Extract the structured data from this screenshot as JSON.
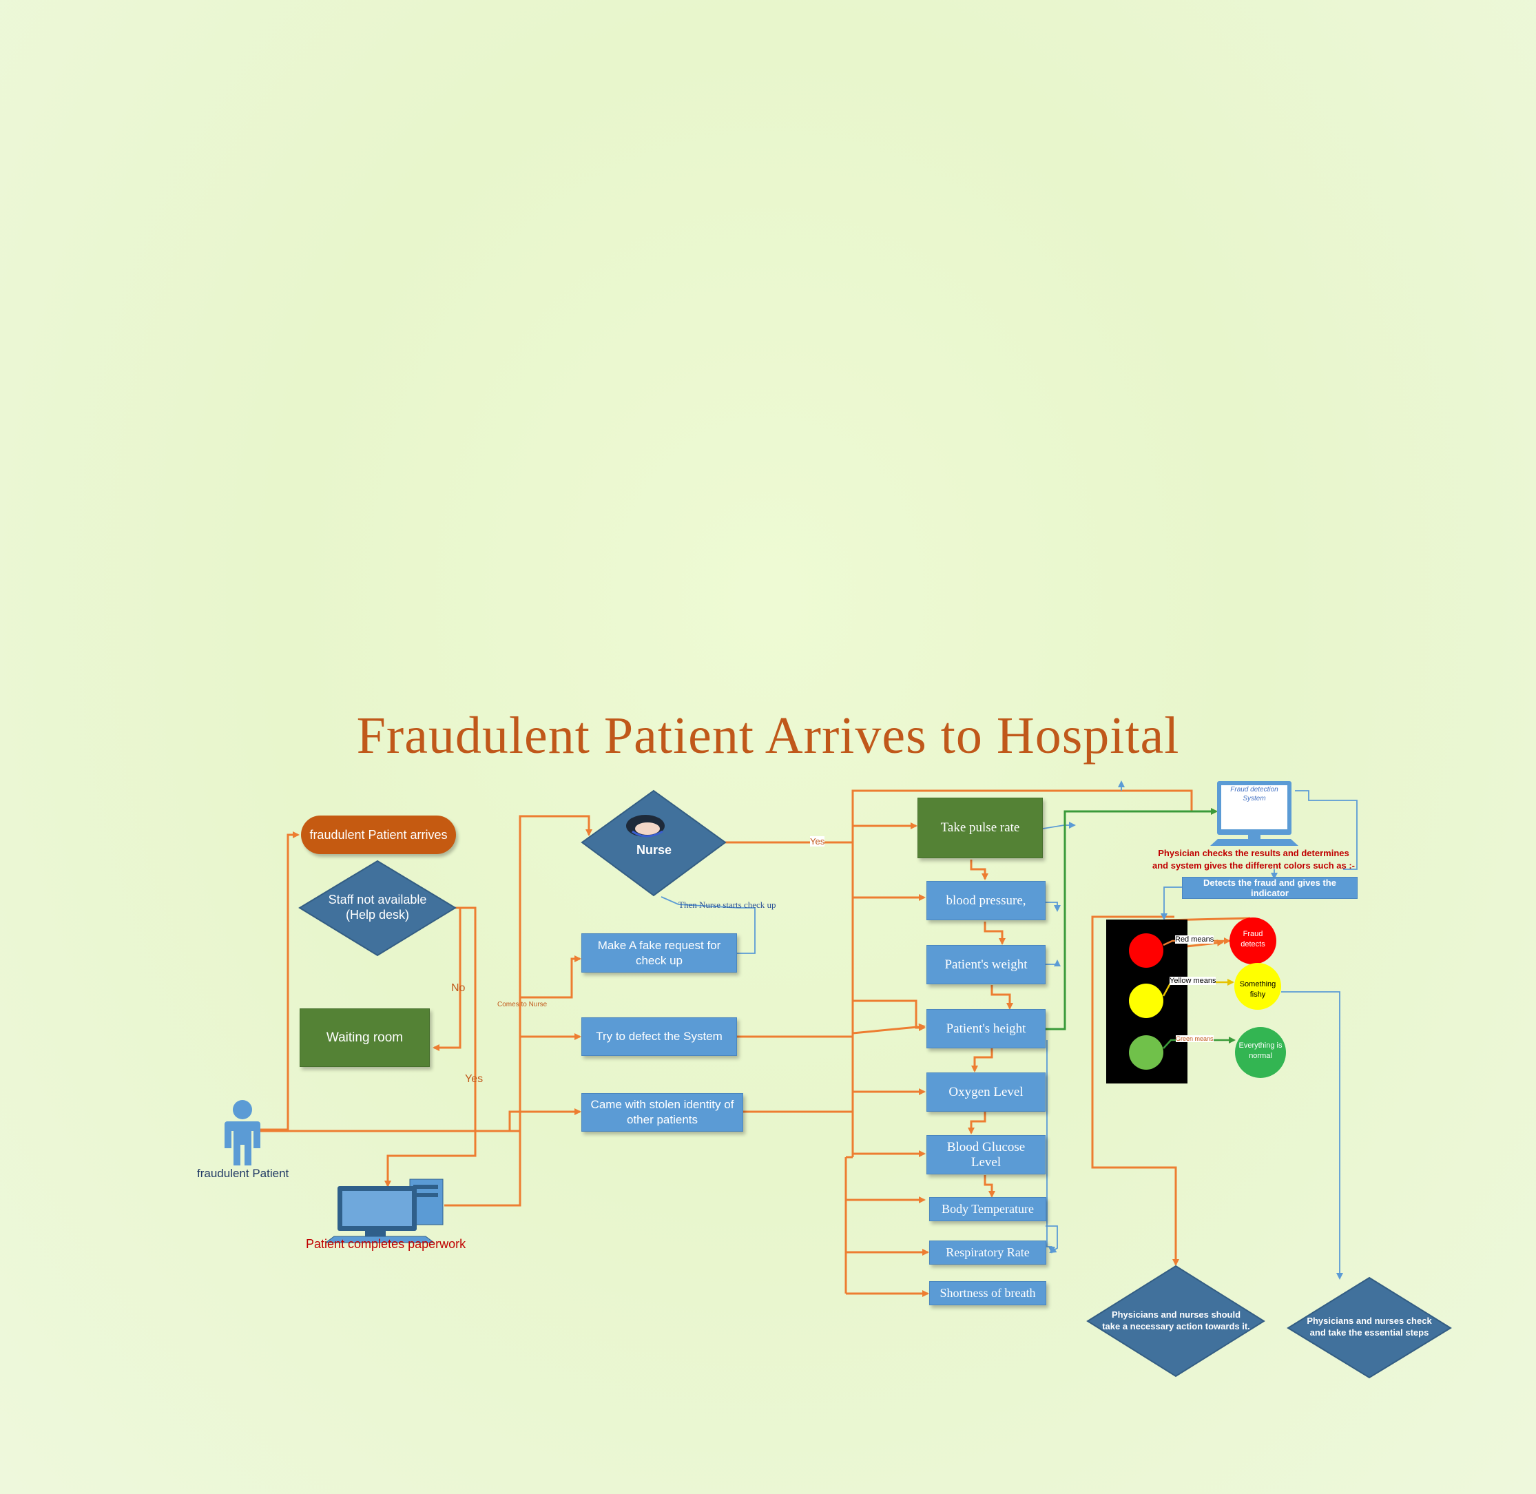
{
  "title": "Fraudulent Patient Arrives to Hospital",
  "colors": {
    "orange": "#ed7d31",
    "blue_box": "#5b9bd5",
    "green_box": "#548235",
    "diamond": "#41719c",
    "title": "#c0581a",
    "red": "#ff0000",
    "yellow": "#ffff00",
    "light_green": "#70c14a"
  },
  "icons": {
    "patient": "person-icon",
    "computer": "computer-icon",
    "nurse": "nurse-avatar-icon",
    "fds": "monitor-icon"
  },
  "left": {
    "arrives": "fraudulent Patient arrives",
    "staff_line1": "Staff not available",
    "staff_line2": "(Help desk)",
    "waiting": "Waiting room",
    "patient_label": "fraudulent Patient",
    "paperwork": "Patient completes paperwork",
    "no": "No",
    "yes": "Yes"
  },
  "middle": {
    "nurse": "Nurse",
    "then_nurse": "Then Nurse starts check up",
    "fake_request": "Make A fake request for check up",
    "defect": "Try to defect the System",
    "stolen": "Came with stolen identity of other patients",
    "comes_to_nurse": "Comes to Nurse",
    "yes": "Yes"
  },
  "checks": [
    "Take pulse rate",
    "blood pressure,",
    "Patient's  weight",
    "Patient's height",
    "Oxygen Level",
    "Blood Glucose Level",
    "Body Temperature",
    "Respiratory Rate",
    "Shortness of breath"
  ],
  "system": {
    "fds_label": "Fraud detection System",
    "physician_note": "Physician checks the results and determines and system gives the different colors such as :-",
    "detects": "Detects the fraud and gives the indicator",
    "red_means": "Red means",
    "yellow_means": "Yellow means",
    "green_means": "Green means",
    "fraud": "Fraud detects",
    "fishy": "Something fishy",
    "normal": "Everything is normal",
    "action1": "Physicians and nurses should take a necessary  action towards it.",
    "action2": "Physicians and nurses check and take the essential steps"
  }
}
